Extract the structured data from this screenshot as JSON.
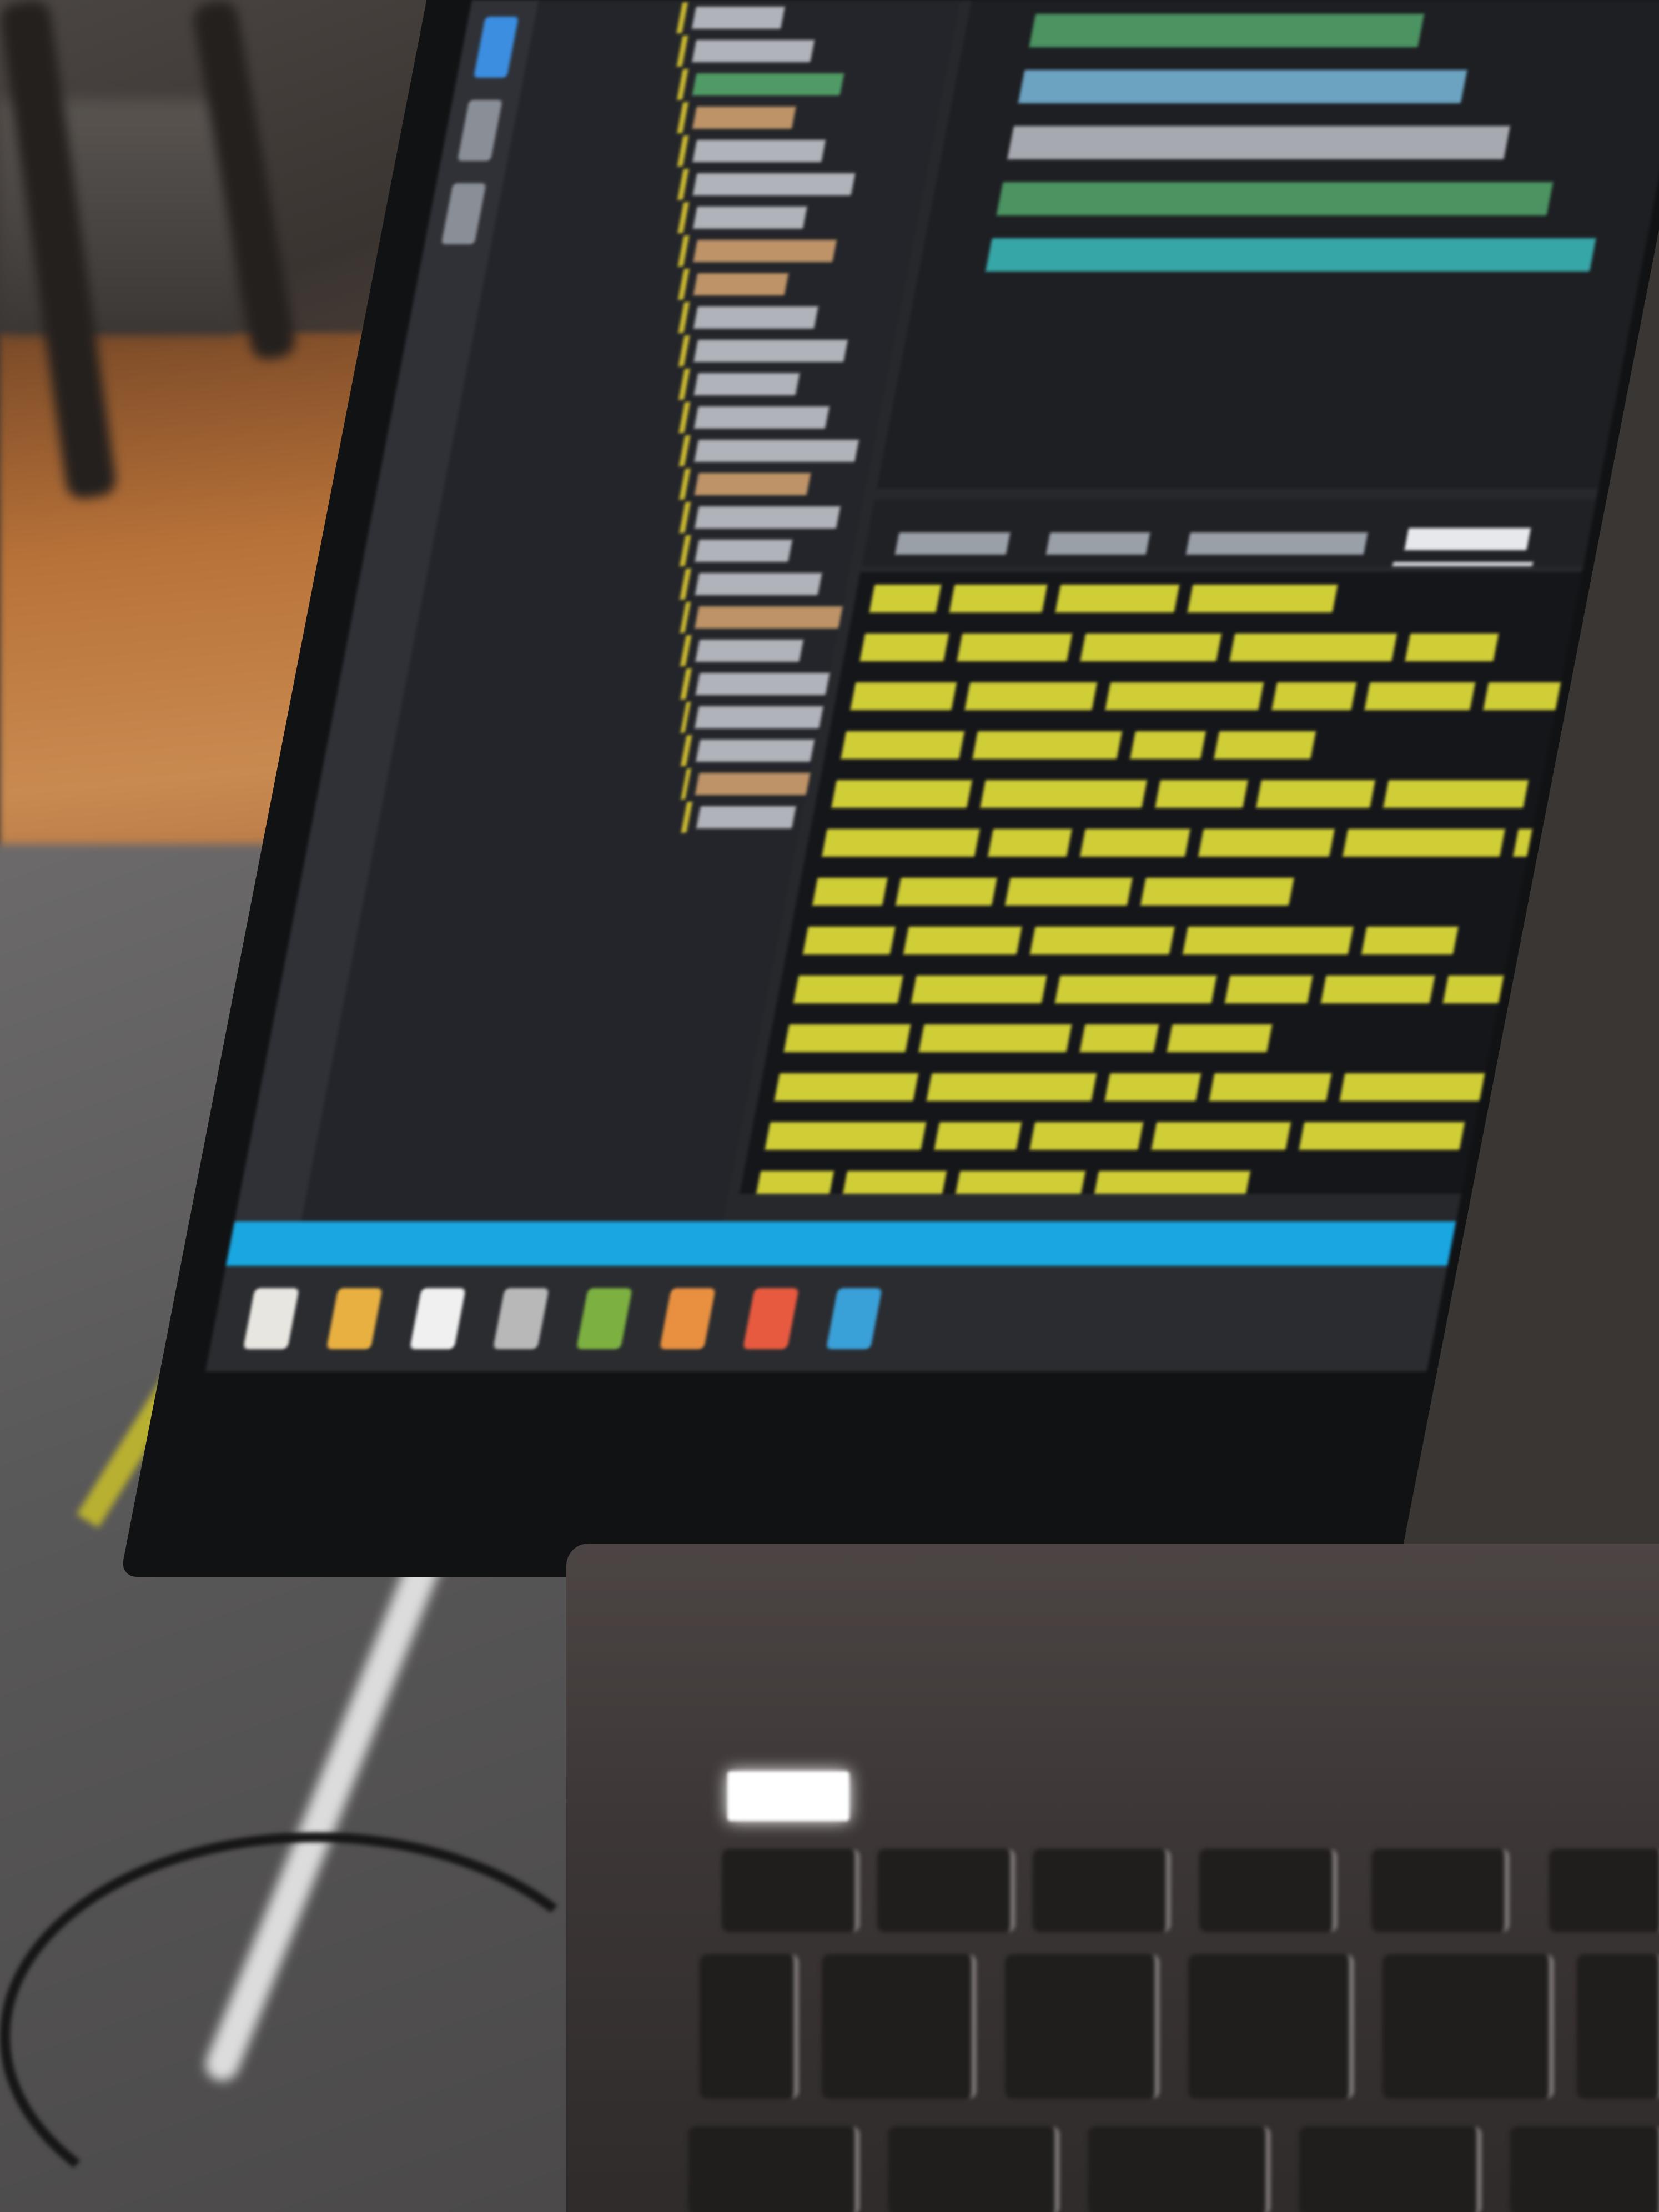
{
  "scene": {
    "description_free": true,
    "screen_accent_colors": {
      "terminal_text": "#e4e23a",
      "statusbar": "#1aa6e0",
      "folder": "#d8a772",
      "keyword": "#58b070",
      "string": "#7fc4e8"
    }
  },
  "activity_bar": {
    "icons": [
      "files-icon",
      "search-icon",
      "source-control-icon"
    ]
  },
  "explorer": {
    "rows": [
      {
        "type": "file",
        "text": ""
      },
      {
        "type": "file",
        "text": ""
      },
      {
        "type": "green",
        "text": ""
      },
      {
        "type": "folder",
        "text": ""
      },
      {
        "type": "file",
        "text": ""
      },
      {
        "type": "file",
        "text": ""
      },
      {
        "type": "file",
        "text": ""
      },
      {
        "type": "folder",
        "text": ""
      },
      {
        "type": "folder",
        "text": ""
      },
      {
        "type": "file",
        "text": ""
      },
      {
        "type": "file",
        "text": ""
      },
      {
        "type": "file",
        "text": ""
      },
      {
        "type": "file",
        "text": ""
      },
      {
        "type": "file",
        "text": ""
      },
      {
        "type": "folder",
        "text": ""
      },
      {
        "type": "file",
        "text": ""
      },
      {
        "type": "file",
        "text": ""
      },
      {
        "type": "file",
        "text": ""
      },
      {
        "type": "folder",
        "text": ""
      },
      {
        "type": "file",
        "text": ""
      },
      {
        "type": "file",
        "text": ""
      },
      {
        "type": "file",
        "text": ""
      },
      {
        "type": "file",
        "text": ""
      },
      {
        "type": "folder",
        "text": ""
      },
      {
        "type": "file",
        "text": ""
      }
    ]
  },
  "editor": {
    "lines": [
      {
        "color": "#58b070",
        "text": ""
      },
      {
        "color": "#7fc4e8",
        "text": ""
      },
      {
        "color": "#c9ccd3",
        "text": ""
      },
      {
        "color": "#58b070",
        "text": ""
      },
      {
        "color": "#3fc8c8",
        "text": ""
      }
    ]
  },
  "panel": {
    "tabs": [
      {
        "label": "",
        "active": false
      },
      {
        "label": "",
        "active": false
      },
      {
        "label": "",
        "active": false
      },
      {
        "label": "",
        "active": true
      }
    ]
  },
  "terminal": {
    "line_count": 16
  },
  "statusbar": {
    "text": ""
  },
  "taskbar": {
    "icons": [
      {
        "name": "file-icon",
        "color": "#e8e6e0"
      },
      {
        "name": "folder-icon",
        "color": "#e8b040"
      },
      {
        "name": "document-icon",
        "color": "#f0f0f0"
      },
      {
        "name": "app-icon",
        "color": "#b8b8b8"
      },
      {
        "name": "app-icon",
        "color": "#7cb040"
      },
      {
        "name": "browser-icon",
        "color": "#e89040"
      },
      {
        "name": "browser-icon",
        "color": "#e85a40"
      },
      {
        "name": "app-icon",
        "color": "#3aa0d8"
      }
    ]
  }
}
